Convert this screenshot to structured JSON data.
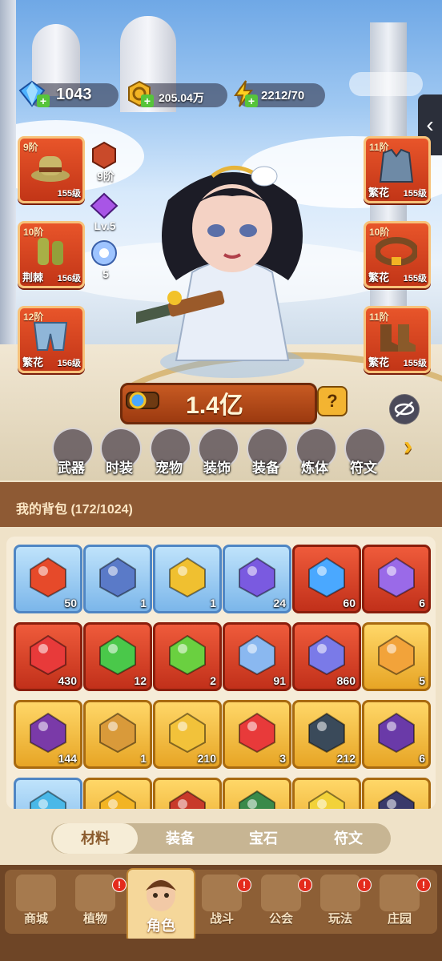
{
  "currency": {
    "gems": "1043",
    "gold": "205.04万",
    "energy": "2212/70"
  },
  "left_slots": [
    {
      "tier": "9阶",
      "level": "155级",
      "tag": "",
      "icon": "hat-icon"
    },
    {
      "tier": "10阶",
      "level": "156级",
      "tag": "荆棘",
      "icon": "gloves-icon"
    },
    {
      "tier": "12阶",
      "level": "156级",
      "tag": "繁花",
      "icon": "shorts-icon"
    }
  ],
  "right_slots": [
    {
      "tier": "11阶",
      "level": "155级",
      "tag": "繁花",
      "icon": "vest-icon"
    },
    {
      "tier": "10阶",
      "level": "155级",
      "tag": "繁花",
      "icon": "belt-icon"
    },
    {
      "tier": "11阶",
      "level": "155级",
      "tag": "繁花",
      "icon": "boots-icon"
    }
  ],
  "mid_badges": {
    "armor_tier": "9阶",
    "crystal_level": "Lv.5",
    "orb_count": "5"
  },
  "power": {
    "value": "1.4亿",
    "help": "?"
  },
  "categories": [
    "武器",
    "时装",
    "宠物",
    "装饰",
    "装备",
    "炼体",
    "符文"
  ],
  "bag": {
    "title": "我的背包 (172/1024)",
    "items": [
      {
        "rarity": "blue",
        "count": "50",
        "icon": "scarab-icon"
      },
      {
        "rarity": "blue",
        "count": "1",
        "icon": "mask-icon"
      },
      {
        "rarity": "blue",
        "count": "1",
        "icon": "lantern-icon"
      },
      {
        "rarity": "blue",
        "count": "24",
        "icon": "compass-icon"
      },
      {
        "rarity": "red",
        "count": "60",
        "icon": "star-crystal-icon"
      },
      {
        "rarity": "red",
        "count": "6",
        "icon": "moon-crystal-icon"
      },
      {
        "rarity": "red",
        "count": "430",
        "icon": "potion-icon"
      },
      {
        "rarity": "red",
        "count": "12",
        "icon": "vial-icon"
      },
      {
        "rarity": "red",
        "count": "2",
        "icon": "green-gem-icon"
      },
      {
        "rarity": "red",
        "count": "91",
        "icon": "hexagram-icon"
      },
      {
        "rarity": "red",
        "count": "860",
        "icon": "cube-cluster-icon"
      },
      {
        "rarity": "gold",
        "count": "5",
        "icon": "perfume-icon"
      },
      {
        "rarity": "gold",
        "count": "144",
        "icon": "skull-flag-icon"
      },
      {
        "rarity": "gold",
        "count": "1",
        "icon": "cookie-icon"
      },
      {
        "rarity": "gold",
        "count": "210",
        "icon": "ankh-icon"
      },
      {
        "rarity": "gold",
        "count": "3",
        "icon": "key-icon"
      },
      {
        "rarity": "gold",
        "count": "212",
        "icon": "pyramid-icon"
      },
      {
        "rarity": "gold",
        "count": "6",
        "icon": "star-orb-icon"
      },
      {
        "rarity": "blue",
        "count": "",
        "icon": "blue-ore-icon"
      },
      {
        "rarity": "gold",
        "count": "",
        "icon": "gold-orb-icon"
      },
      {
        "rarity": "gold",
        "count": "",
        "icon": "chest-icon"
      },
      {
        "rarity": "gold",
        "count": "",
        "icon": "green-shard-icon"
      },
      {
        "rarity": "gold",
        "count": "",
        "icon": "gold-scroll-icon"
      },
      {
        "rarity": "gold",
        "count": "",
        "icon": "dark-rune-icon"
      }
    ]
  },
  "tabs": [
    "材料",
    "装备",
    "宝石",
    "符文"
  ],
  "active_tab": "材料",
  "nav": [
    {
      "label": "商城",
      "badge": false
    },
    {
      "label": "植物",
      "badge": true
    },
    {
      "label": "角色",
      "badge": false,
      "active": true
    },
    {
      "label": "战斗",
      "badge": true
    },
    {
      "label": "公会",
      "badge": true
    },
    {
      "label": "玩法",
      "badge": true
    },
    {
      "label": "庄园",
      "badge": true
    }
  ],
  "colors": {
    "slot_red": "#d8401f",
    "rare_blue": "#7bb6ea",
    "epic_gold": "#f0b83a",
    "brown_panel": "#8e5a34"
  }
}
